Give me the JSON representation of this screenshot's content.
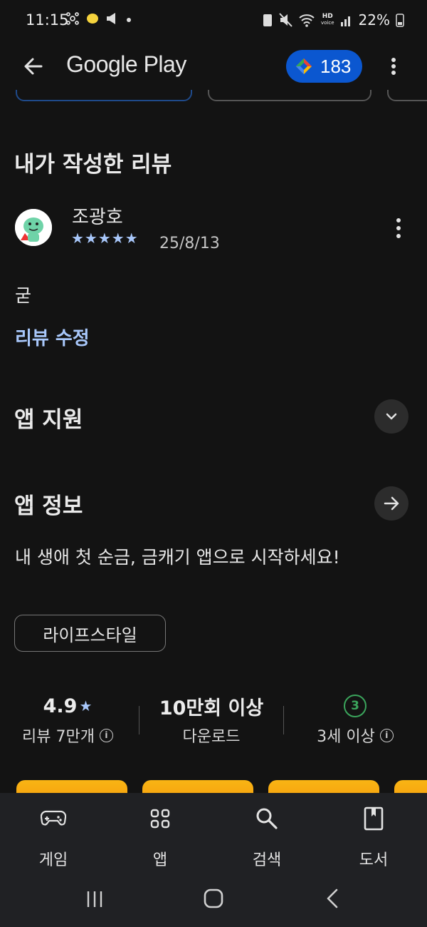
{
  "status_bar": {
    "time": "11:15",
    "battery": "22%"
  },
  "app_bar": {
    "title": "Google Play",
    "points": "183"
  },
  "review_section": {
    "title": "내가 작성한 리뷰",
    "reviewer_name": "조광호",
    "stars": "★★★★★",
    "rating": 5,
    "date": "25/8/13",
    "text": "굳",
    "edit_label": "리뷰 수정"
  },
  "app_support": {
    "title": "앱 지원"
  },
  "app_info": {
    "title": "앱 정보",
    "tagline": "내 생애 첫 순금, 금캐기 앱으로 시작하세요!",
    "category": "라이프스타일"
  },
  "stats": {
    "rating_value": "4.9",
    "rating_star": "★",
    "reviews_label": "리뷰 7만개",
    "downloads_value": "10만회 이상",
    "downloads_label": "다운로드",
    "age_badge": "3",
    "age_label": "3세 이상"
  },
  "bottom_nav": {
    "items": [
      {
        "label": "게임",
        "icon": "gamepad-icon"
      },
      {
        "label": "앱",
        "icon": "apps-grid-icon"
      },
      {
        "label": "검색",
        "icon": "search-icon"
      },
      {
        "label": "도서",
        "icon": "book-icon"
      }
    ]
  },
  "colors": {
    "background": "#131313",
    "accent_blue": "#0b57d0",
    "link_blue": "#a8c7fa",
    "age_green": "#3ba55c",
    "nav_background": "#202124"
  }
}
